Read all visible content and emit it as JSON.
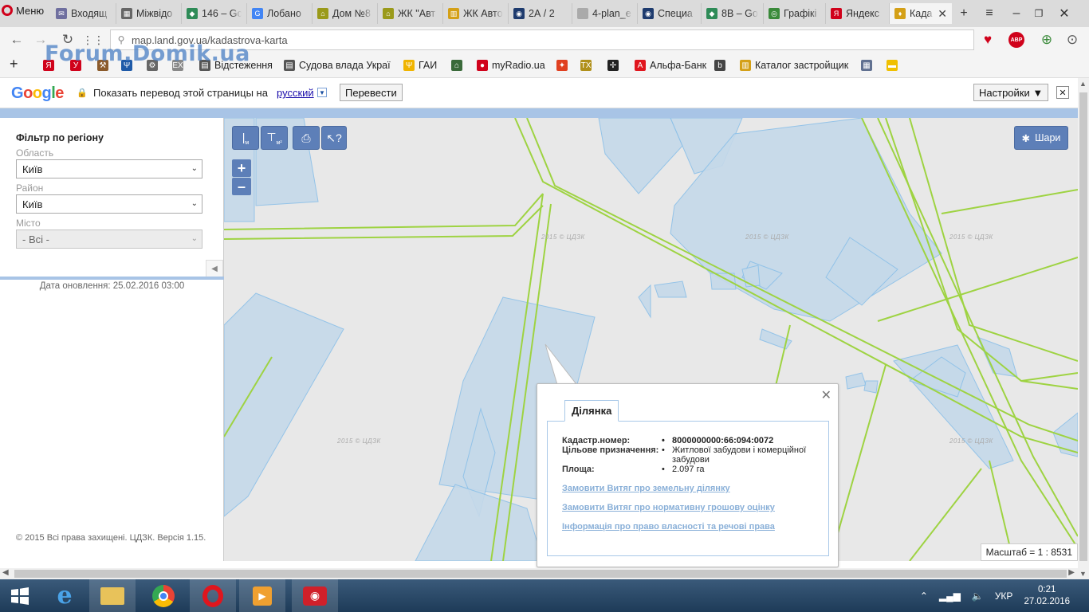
{
  "browser": {
    "menu_label": "Меню",
    "tabs": [
      {
        "title": "Входящ",
        "color": "#6f6f9f",
        "glyph": "✉"
      },
      {
        "title": "Міжвідо",
        "color": "#666",
        "glyph": "▦"
      },
      {
        "title": "146 – Gc",
        "color": "#2e8b57",
        "glyph": "◆"
      },
      {
        "title": "Лобано",
        "color": "#4285f4",
        "glyph": "G"
      },
      {
        "title": "Дом №8",
        "color": "#9a9a1a",
        "glyph": "⌂"
      },
      {
        "title": "ЖК \"Авт",
        "color": "#9a9a1a",
        "glyph": "⌂"
      },
      {
        "title": "ЖК Авто",
        "color": "#d4a017",
        "glyph": "▥"
      },
      {
        "title": "2А / 2",
        "color": "#1e3b6e",
        "glyph": "◉"
      },
      {
        "title": "4-plan_e",
        "color": "#aaa",
        "glyph": ""
      },
      {
        "title": "Специа",
        "color": "#1e3b6e",
        "glyph": "◉"
      },
      {
        "title": "8В – Goc",
        "color": "#2e8b57",
        "glyph": "◆"
      },
      {
        "title": "Графікі",
        "color": "#3a8a3a",
        "glyph": "◎"
      },
      {
        "title": "Яндекс",
        "color": "#d0021b",
        "glyph": "Я"
      },
      {
        "title": "Када",
        "color": "#d4a017",
        "glyph": "♦"
      }
    ],
    "url": "map.land.gov.ua/kadastrova-karta",
    "bookmarks": [
      {
        "label": "",
        "icon": "yandex-icon"
      },
      {
        "label": "",
        "icon": "y-icon"
      },
      {
        "label": "",
        "icon": "hammer-icon"
      },
      {
        "label": "",
        "icon": "ua-trident-icon"
      },
      {
        "label": "",
        "icon": "tools-icon"
      },
      {
        "label": "",
        "icon": "ex-icon"
      },
      {
        "label": "Відстеження",
        "icon": "page-icon"
      },
      {
        "label": "Судова влада Украї",
        "icon": "page-icon"
      },
      {
        "label": "ГАИ",
        "icon": "trident-icon"
      },
      {
        "label": "",
        "icon": "building-icon"
      },
      {
        "label": "myRadio.ua",
        "icon": "radio-icon"
      },
      {
        "label": "",
        "icon": "bird-icon"
      },
      {
        "label": "",
        "icon": "tx-icon"
      },
      {
        "label": "",
        "icon": "pinwheel-icon"
      },
      {
        "label": "Альфа-Банк",
        "icon": "alfa-icon"
      },
      {
        "label": "",
        "icon": "b-icon"
      },
      {
        "label": "Каталог застройщик",
        "icon": "catalog-icon"
      },
      {
        "label": "",
        "icon": "grid-icon"
      },
      {
        "label": "",
        "icon": "ua-flag-icon"
      }
    ],
    "watermark": "Forum.Domik.ua"
  },
  "translate_bar": {
    "message": "Показать перевод этой страницы на",
    "language": "русский",
    "translate_button": "Перевести",
    "settings_button": "Настройки ▼"
  },
  "filter": {
    "title": "Фільтр по регіону",
    "oblast_label": "Область",
    "oblast_value": "Київ",
    "raion_label": "Район",
    "raion_value": "Київ",
    "misto_label": "Місто",
    "misto_value": "- Всі -",
    "updated": "Дата оновлення: 25.02.2016 03:00",
    "copyright": "© 2015 Всі права захищені. ЦДЗК. Версія 1.15."
  },
  "map": {
    "layers_button": "Шари",
    "zoom_in": "+",
    "zoom_out": "–",
    "scale": "Масштаб = 1 : 8531",
    "tile_watermark": "2015 © ЦДЗК",
    "parcel_fill": "#c5d9ea",
    "parcel_stroke": "#8cc0e8",
    "road_color": "#9ed342"
  },
  "popup": {
    "tab": "Ділянка",
    "rows": [
      {
        "key": "Кадастр.номер:",
        "value": "8000000000:66:094:0072"
      },
      {
        "key": "Цільове призначення:",
        "value": "Житлової забудови і комерційної забудови"
      },
      {
        "key": "Площа:",
        "value": "2.097 га"
      }
    ],
    "links": [
      "Замовити Витяг про земельну ділянку",
      "Замовити Витяг про нормативну грошову оцінку",
      "Інформація про право власності та речові права"
    ]
  },
  "taskbar": {
    "lang": "УКР",
    "time": "0:21",
    "date": "27.02.2016"
  }
}
